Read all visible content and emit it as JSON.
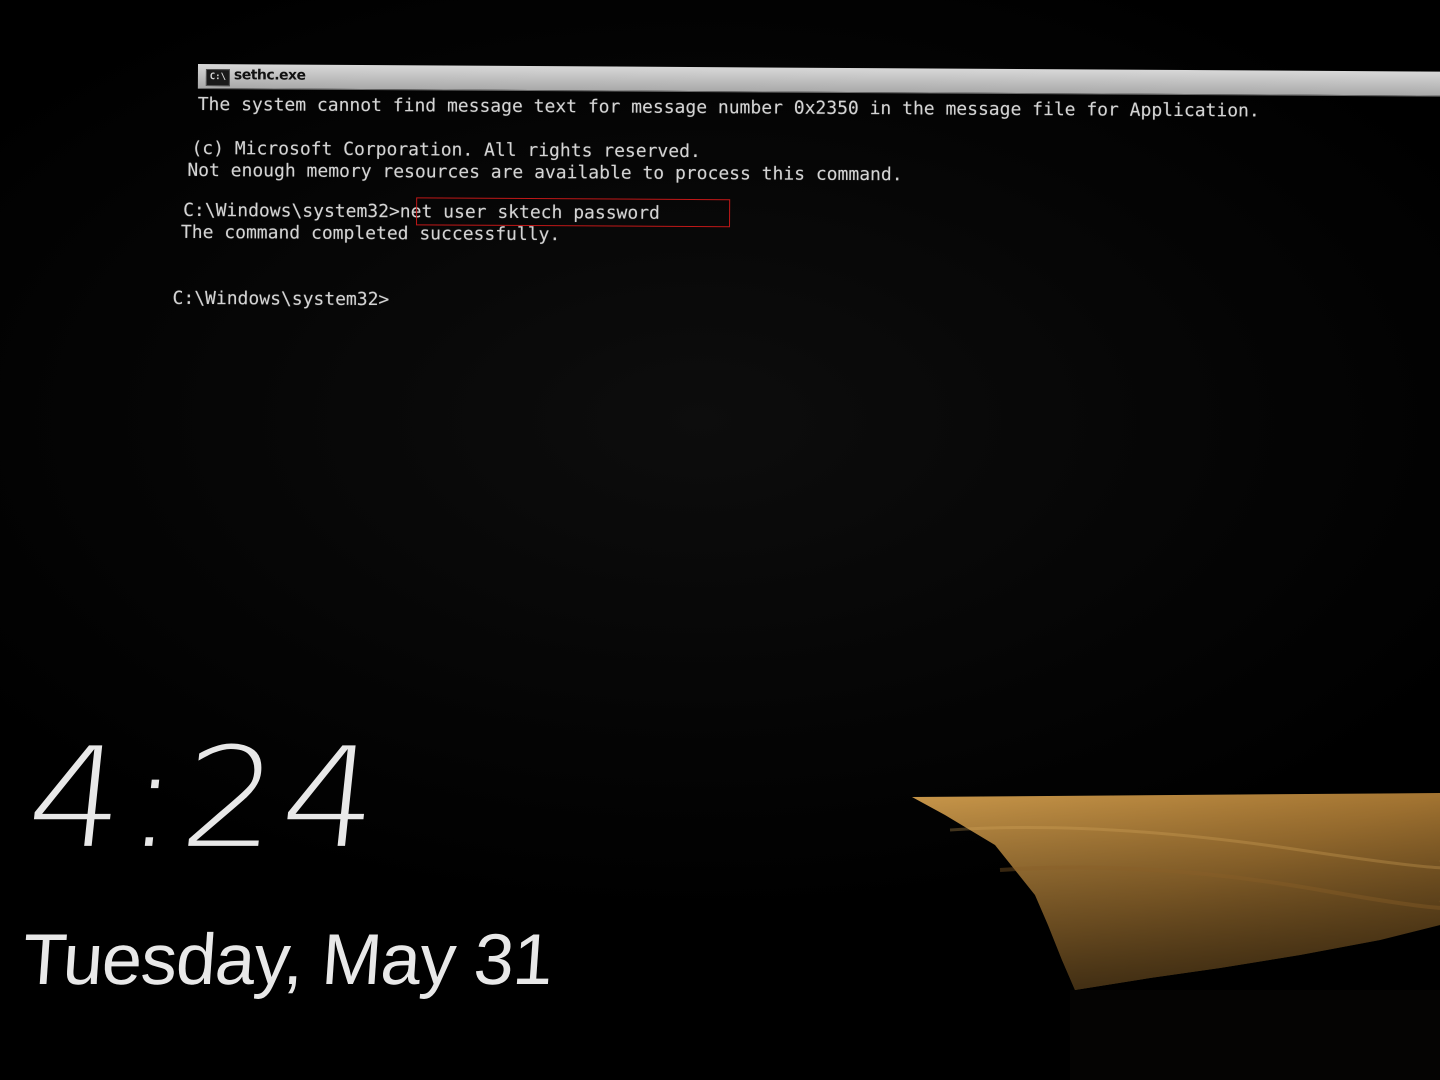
{
  "console": {
    "title": "sethc.exe",
    "icon": "console-app-icon",
    "lines": [
      "The system cannot find message text for message number 0x2350 in the message file for Application.",
      "",
      "(c) Microsoft Corporation. All rights reserved.",
      "Not enough memory resources are available to process this command.",
      "",
      "C:\\Windows\\system32>net user sktech password",
      "The command completed successfully.",
      "",
      "",
      "C:\\Windows\\system32>"
    ],
    "highlight_color": "#c01818"
  },
  "lockscreen": {
    "time": "4:24",
    "date": "Tuesday, May 31"
  }
}
